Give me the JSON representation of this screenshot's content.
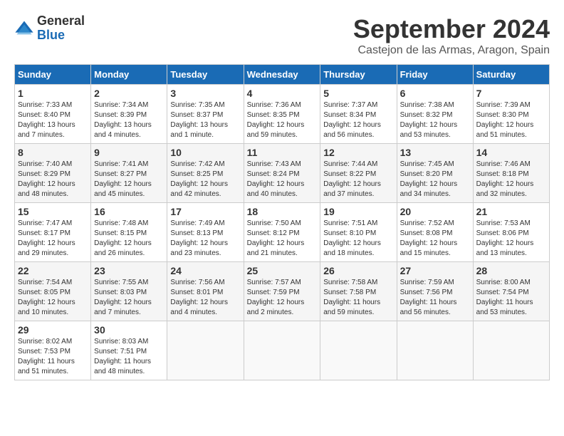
{
  "logo": {
    "text_general": "General",
    "text_blue": "Blue"
  },
  "title": "September 2024",
  "subtitle": "Castejon de las Armas, Aragon, Spain",
  "days_of_week": [
    "Sunday",
    "Monday",
    "Tuesday",
    "Wednesday",
    "Thursday",
    "Friday",
    "Saturday"
  ],
  "weeks": [
    [
      {
        "day": "1",
        "info": "Sunrise: 7:33 AM\nSunset: 8:40 PM\nDaylight: 13 hours and 7 minutes."
      },
      {
        "day": "2",
        "info": "Sunrise: 7:34 AM\nSunset: 8:39 PM\nDaylight: 13 hours and 4 minutes."
      },
      {
        "day": "3",
        "info": "Sunrise: 7:35 AM\nSunset: 8:37 PM\nDaylight: 13 hours and 1 minute."
      },
      {
        "day": "4",
        "info": "Sunrise: 7:36 AM\nSunset: 8:35 PM\nDaylight: 12 hours and 59 minutes."
      },
      {
        "day": "5",
        "info": "Sunrise: 7:37 AM\nSunset: 8:34 PM\nDaylight: 12 hours and 56 minutes."
      },
      {
        "day": "6",
        "info": "Sunrise: 7:38 AM\nSunset: 8:32 PM\nDaylight: 12 hours and 53 minutes."
      },
      {
        "day": "7",
        "info": "Sunrise: 7:39 AM\nSunset: 8:30 PM\nDaylight: 12 hours and 51 minutes."
      }
    ],
    [
      {
        "day": "8",
        "info": "Sunrise: 7:40 AM\nSunset: 8:29 PM\nDaylight: 12 hours and 48 minutes."
      },
      {
        "day": "9",
        "info": "Sunrise: 7:41 AM\nSunset: 8:27 PM\nDaylight: 12 hours and 45 minutes."
      },
      {
        "day": "10",
        "info": "Sunrise: 7:42 AM\nSunset: 8:25 PM\nDaylight: 12 hours and 42 minutes."
      },
      {
        "day": "11",
        "info": "Sunrise: 7:43 AM\nSunset: 8:24 PM\nDaylight: 12 hours and 40 minutes."
      },
      {
        "day": "12",
        "info": "Sunrise: 7:44 AM\nSunset: 8:22 PM\nDaylight: 12 hours and 37 minutes."
      },
      {
        "day": "13",
        "info": "Sunrise: 7:45 AM\nSunset: 8:20 PM\nDaylight: 12 hours and 34 minutes."
      },
      {
        "day": "14",
        "info": "Sunrise: 7:46 AM\nSunset: 8:18 PM\nDaylight: 12 hours and 32 minutes."
      }
    ],
    [
      {
        "day": "15",
        "info": "Sunrise: 7:47 AM\nSunset: 8:17 PM\nDaylight: 12 hours and 29 minutes."
      },
      {
        "day": "16",
        "info": "Sunrise: 7:48 AM\nSunset: 8:15 PM\nDaylight: 12 hours and 26 minutes."
      },
      {
        "day": "17",
        "info": "Sunrise: 7:49 AM\nSunset: 8:13 PM\nDaylight: 12 hours and 23 minutes."
      },
      {
        "day": "18",
        "info": "Sunrise: 7:50 AM\nSunset: 8:12 PM\nDaylight: 12 hours and 21 minutes."
      },
      {
        "day": "19",
        "info": "Sunrise: 7:51 AM\nSunset: 8:10 PM\nDaylight: 12 hours and 18 minutes."
      },
      {
        "day": "20",
        "info": "Sunrise: 7:52 AM\nSunset: 8:08 PM\nDaylight: 12 hours and 15 minutes."
      },
      {
        "day": "21",
        "info": "Sunrise: 7:53 AM\nSunset: 8:06 PM\nDaylight: 12 hours and 13 minutes."
      }
    ],
    [
      {
        "day": "22",
        "info": "Sunrise: 7:54 AM\nSunset: 8:05 PM\nDaylight: 12 hours and 10 minutes."
      },
      {
        "day": "23",
        "info": "Sunrise: 7:55 AM\nSunset: 8:03 PM\nDaylight: 12 hours and 7 minutes."
      },
      {
        "day": "24",
        "info": "Sunrise: 7:56 AM\nSunset: 8:01 PM\nDaylight: 12 hours and 4 minutes."
      },
      {
        "day": "25",
        "info": "Sunrise: 7:57 AM\nSunset: 7:59 PM\nDaylight: 12 hours and 2 minutes."
      },
      {
        "day": "26",
        "info": "Sunrise: 7:58 AM\nSunset: 7:58 PM\nDaylight: 11 hours and 59 minutes."
      },
      {
        "day": "27",
        "info": "Sunrise: 7:59 AM\nSunset: 7:56 PM\nDaylight: 11 hours and 56 minutes."
      },
      {
        "day": "28",
        "info": "Sunrise: 8:00 AM\nSunset: 7:54 PM\nDaylight: 11 hours and 53 minutes."
      }
    ],
    [
      {
        "day": "29",
        "info": "Sunrise: 8:02 AM\nSunset: 7:53 PM\nDaylight: 11 hours and 51 minutes."
      },
      {
        "day": "30",
        "info": "Sunrise: 8:03 AM\nSunset: 7:51 PM\nDaylight: 11 hours and 48 minutes."
      },
      null,
      null,
      null,
      null,
      null
    ]
  ]
}
